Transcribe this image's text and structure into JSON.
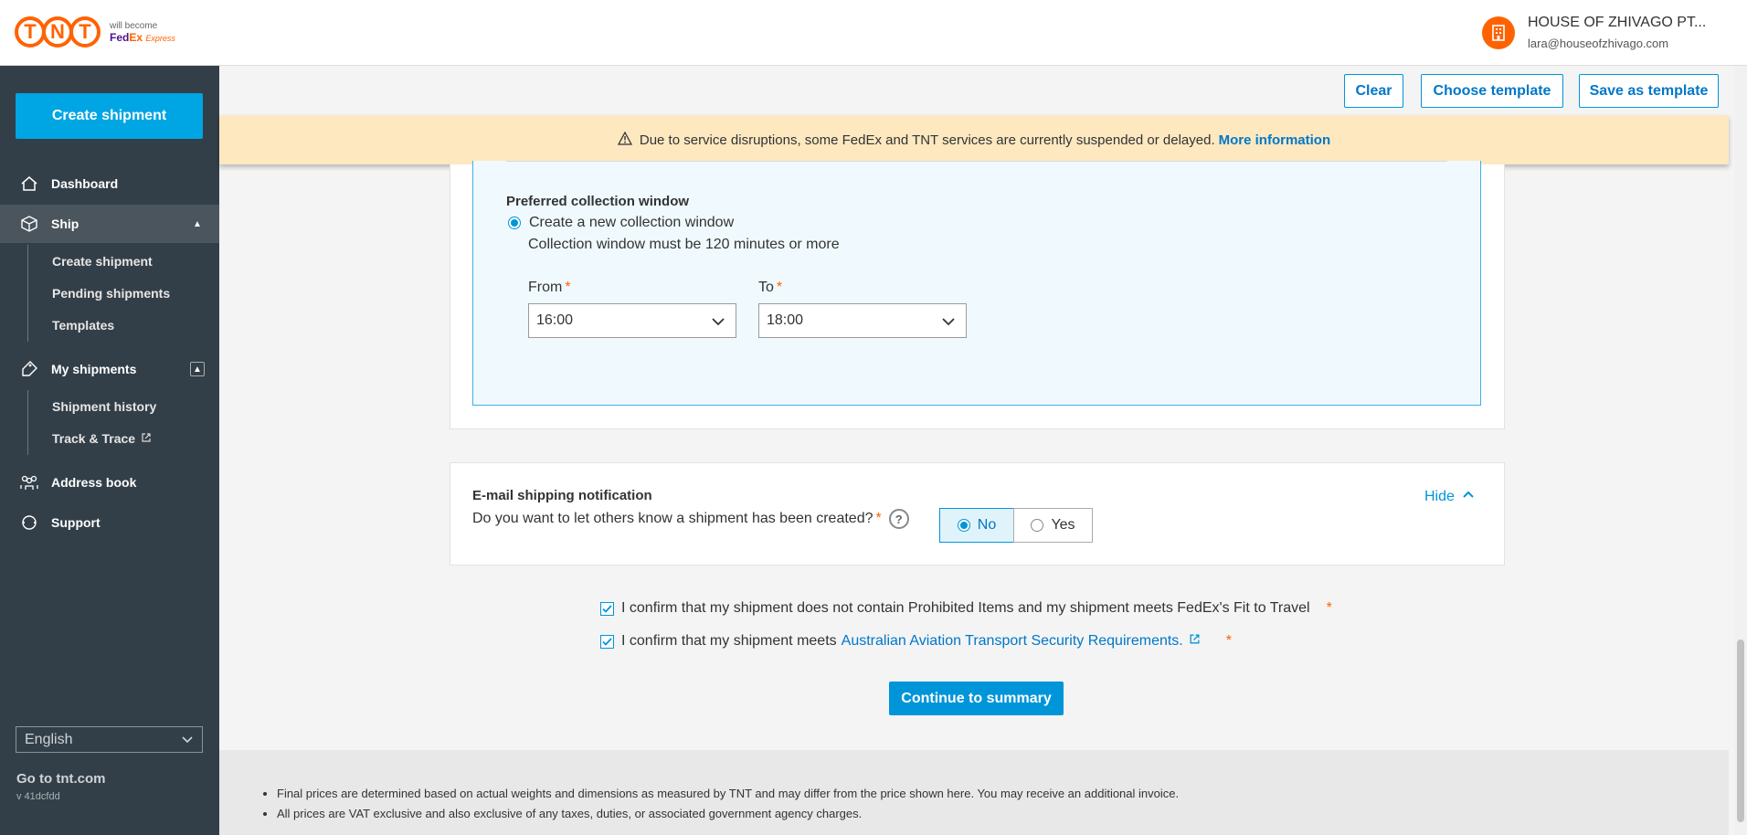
{
  "header": {
    "logo_letters": [
      "T",
      "N",
      "T"
    ],
    "logo_tagline": "will become",
    "logo_brand_a": "Fed",
    "logo_brand_b": "Ex",
    "logo_brand_c": "Express",
    "user_name": "HOUSE OF ZHIVAGO PT...",
    "user_email": "lara@houseofzhivago.com"
  },
  "sidebar": {
    "create_label": "Create shipment",
    "dashboard": "Dashboard",
    "ship": "Ship",
    "ship_items": [
      "Create shipment",
      "Pending shipments",
      "Templates"
    ],
    "my_shipments": "My shipments",
    "my_shipments_items": [
      "Shipment history",
      "Track & Trace"
    ],
    "address_book": "Address book",
    "support": "Support",
    "language": "English",
    "goto": "Go to tnt.com",
    "version": "v 41dcfdd"
  },
  "toolbar": {
    "clear": "Clear",
    "choose_template": "Choose template",
    "save_template": "Save as template"
  },
  "banner": {
    "message": "Due to service disruptions, some FedEx and TNT services are currently suspended or delayed.",
    "link": "More information"
  },
  "collection": {
    "title": "Preferred collection window",
    "option": "Create a new collection window",
    "note": "Collection window must be 120 minutes or more",
    "from_label": "From",
    "from_value": "16:00",
    "to_label": "To",
    "to_value": "18:00"
  },
  "email": {
    "title": "E-mail shipping notification",
    "question": "Do you want to let others know a shipment has been created?",
    "hide": "Hide",
    "no": "No",
    "yes": "Yes"
  },
  "confirm": {
    "line1": "I confirm that my shipment does not contain Prohibited Items and my shipment meets FedEx's Fit to Travel",
    "line2_prefix": "I confirm that my shipment meets",
    "line2_link": "Australian Aviation Transport Security Requirements."
  },
  "continue_label": "Continue to summary",
  "footer": {
    "notes": [
      "Final prices are determined based on actual weights and dimensions as measured by TNT and may differ from the price shown here. You may receive an additional invoice.",
      "All prices are VAT exclusive and also exclusive of any taxes, duties, or associated government agency charges."
    ]
  },
  "colors": {
    "brand_orange": "#ff6200",
    "primary_blue": "#0095d9",
    "sidebar_bg": "#333f48",
    "banner_bg": "#fde8c0"
  }
}
